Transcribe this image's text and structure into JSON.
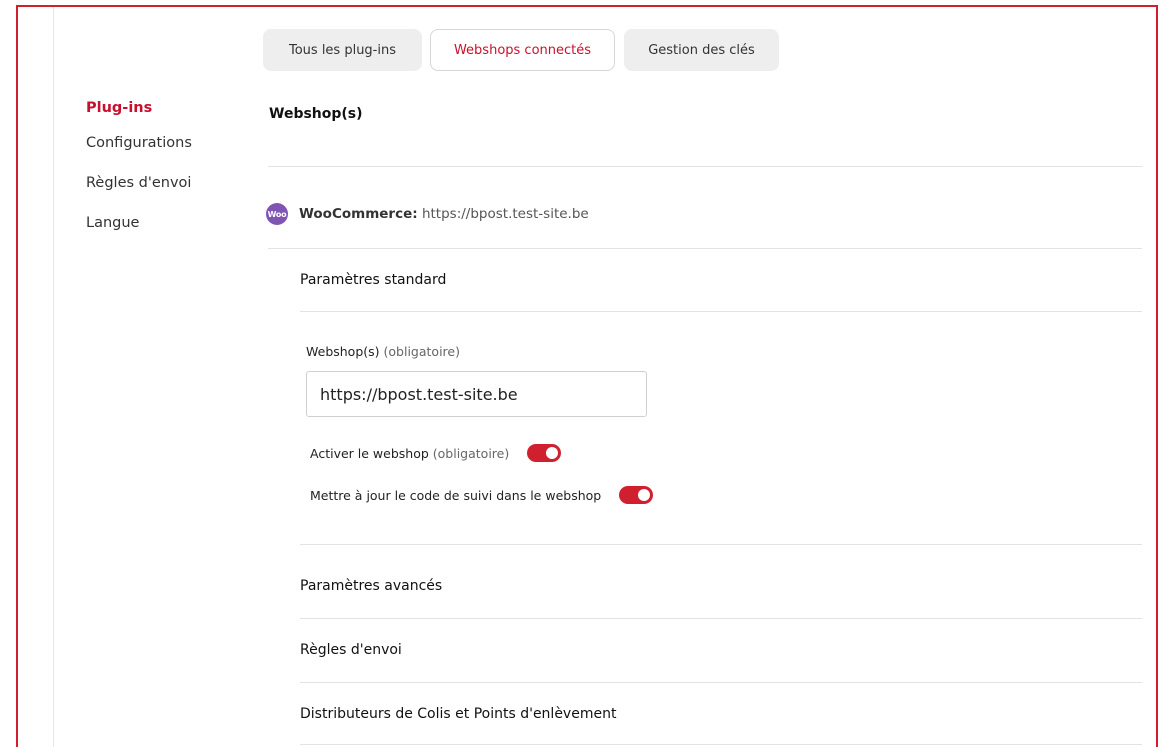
{
  "tabs": {
    "all_plugins": "Tous les plug-ins",
    "connected_webshops": "Webshops connectés",
    "key_management": "Gestion des clés"
  },
  "sidebar": {
    "items": [
      {
        "label": "Plug-ins",
        "active": true
      },
      {
        "label": "Configurations",
        "active": false
      },
      {
        "label": "Règles d'envoi",
        "active": false
      },
      {
        "label": "Langue",
        "active": false
      }
    ]
  },
  "main": {
    "title": "Webshop(s)",
    "webshop": {
      "logo_text": "Woo",
      "platform": "WooCommerce:",
      "url": "https://bpost.test-site.be"
    },
    "standard_section": "Paramètres standard",
    "field": {
      "label": "Webshop(s)",
      "hint": "(obligatoire)",
      "value": "https://bpost.test-site.be"
    },
    "toggles": [
      {
        "label": "Activer le webshop",
        "hint": "(obligatoire)",
        "on": true
      },
      {
        "label": "Mettre à jour le code de suivi dans le webshop",
        "hint": "",
        "on": true
      }
    ],
    "sections": [
      "Paramètres avancés",
      "Règles d'envoi",
      "Distributeurs de Colis et Points d'enlèvement"
    ]
  },
  "colors": {
    "accent": "#c8102e",
    "frame": "#d0202f",
    "woo_purple": "#7f54b3"
  }
}
